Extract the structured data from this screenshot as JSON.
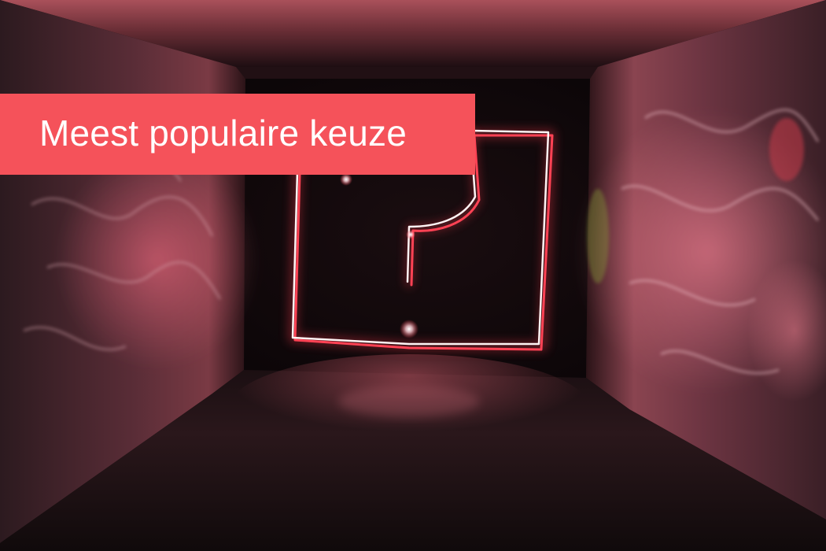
{
  "banner": {
    "label": "Meest populaire keuze",
    "background_color": "#f5525a",
    "text_color": "#ffffff"
  },
  "photo": {
    "subject": "question-mark-light-painting",
    "accent_color": "#ff3b4e",
    "light_color": "#fff4f4"
  }
}
